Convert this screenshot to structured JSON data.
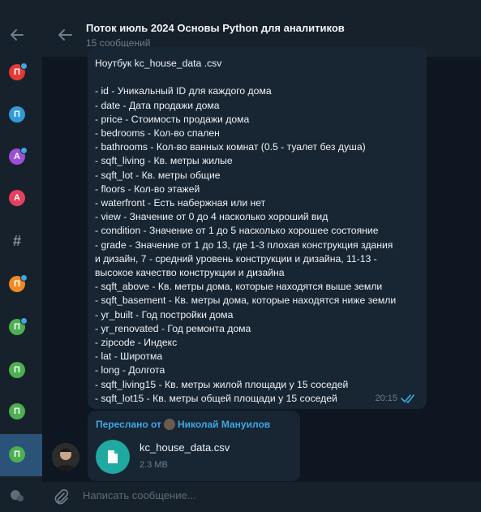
{
  "sidebar": {
    "folders": [
      {
        "letter": "П",
        "color": "#e53935",
        "dot": true
      },
      {
        "letter": "П",
        "color": "#2f9bd8",
        "dot": false
      },
      {
        "letter": "А",
        "color": "#9c4fd6",
        "dot": true
      },
      {
        "letter": "А",
        "color": "#e5405e",
        "dot": false
      },
      {
        "letter": "#",
        "color": "transparent",
        "dot": false
      },
      {
        "letter": "П",
        "color": "#f08a24",
        "dot": true
      },
      {
        "letter": "П",
        "color": "#4caf50",
        "dot": true
      },
      {
        "letter": "П",
        "color": "#4caf50",
        "dot": false
      },
      {
        "letter": "П",
        "color": "#4caf50",
        "dot": false
      },
      {
        "letter": "П",
        "color": "#4caf50",
        "dot": false
      }
    ]
  },
  "header": {
    "title": "Поток июль 2024 Основы Python для аналитиков",
    "subtitle": "15 сообщений"
  },
  "message": {
    "lines": [
      "Ноутбук kc_house_data .csv",
      "",
      "- id - Уникальный ID для каждого дома",
      "- date - Дата продажи дома",
      "- price - Стоимость продажи дома",
      "- bedrooms - Кол-во спален",
      "- bathrooms - Кол-во ванных комнат (0.5 - туалет без душа)",
      "- sqft_living - Кв. метры жилые",
      "- sqft_lot - Кв. метры общие",
      "- floors - Кол-во этажей",
      "- waterfront - Есть набержная или нет",
      "- view - Значение от 0 до 4 насколько хороший вид",
      "- condition - Значение от 1 до 5 насколько хорошее состояние",
      "- grade - Значение от 1 до 13, где 1-3 плохая конструкция здания",
      "и дизайн, 7 - средний уровень конструкции и дизайна, 11-13 -",
      "высокое качество конструкции и дизайна",
      "- sqft_above - Кв. метры дома, которые находятся выше земли",
      "- sqft_basement - Кв. метры дома, которые находятся ниже земли",
      "- yr_built - Год постройки дома",
      "- yr_renovated - Год ремонта дома",
      "- zipcode - Индекс",
      "- lat - Широтма",
      "- long - Долгота",
      "- sqft_living15 - Кв. метры жилой площади у 15 соседей",
      "- sqft_lot15 - Кв. метры общей площади у 15 соседей"
    ],
    "time": "20:15"
  },
  "forward": {
    "label": "Переслано от",
    "author": "Николай Мануилов",
    "file_name": "kc_house_data.csv",
    "file_size": "2.3 MB"
  },
  "input": {
    "placeholder": "Написать сообщение..."
  },
  "colors": {
    "accent": "#3fa7e3",
    "file": "#1fa9a0",
    "bubble": "#182533",
    "active_folder": "#2b5278"
  }
}
